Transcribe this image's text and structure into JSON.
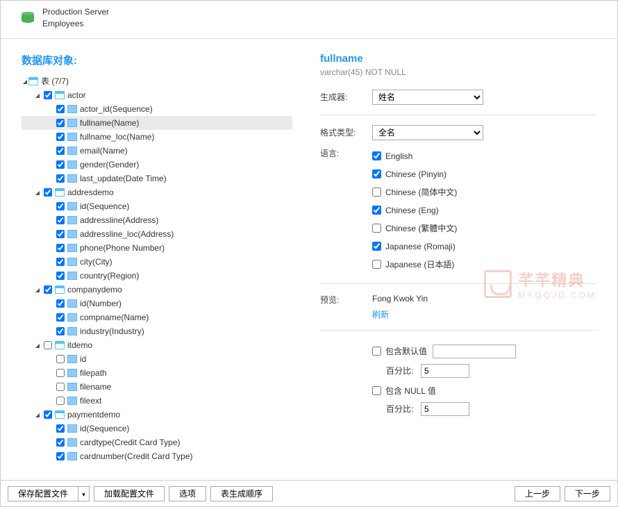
{
  "header": {
    "server": "Production Server",
    "db": "Employees"
  },
  "left_title": "数据库对象:",
  "tree_root_label": "表 (7/7)",
  "tables": [
    {
      "name": "actor",
      "checked": true,
      "expanded": true,
      "columns": [
        {
          "label": "actor_id(Sequence)",
          "checked": true
        },
        {
          "label": "fullname(Name)",
          "checked": true,
          "selected": true
        },
        {
          "label": "fullname_loc(Name)",
          "checked": true
        },
        {
          "label": "email(Name)",
          "checked": true
        },
        {
          "label": "gender(Gender)",
          "checked": true
        },
        {
          "label": "last_update(Date Time)",
          "checked": true
        }
      ]
    },
    {
      "name": "addresdemo",
      "checked": true,
      "expanded": true,
      "columns": [
        {
          "label": "id(Sequence)",
          "checked": true
        },
        {
          "label": "addressline(Address)",
          "checked": true
        },
        {
          "label": "addressline_loc(Address)",
          "checked": true
        },
        {
          "label": "phone(Phone Number)",
          "checked": true
        },
        {
          "label": "city(City)",
          "checked": true
        },
        {
          "label": "country(Region)",
          "checked": true
        }
      ]
    },
    {
      "name": "companydemo",
      "checked": true,
      "expanded": true,
      "columns": [
        {
          "label": "id(Number)",
          "checked": true
        },
        {
          "label": "compname(Name)",
          "checked": true
        },
        {
          "label": "industry(Industry)",
          "checked": true
        }
      ]
    },
    {
      "name": "itdemo",
      "checked": false,
      "expanded": true,
      "columns": [
        {
          "label": "id",
          "checked": false
        },
        {
          "label": "filepath",
          "checked": false
        },
        {
          "label": "filename",
          "checked": false
        },
        {
          "label": "fileext",
          "checked": false
        }
      ]
    },
    {
      "name": "paymentdemo",
      "checked": true,
      "expanded": true,
      "columns": [
        {
          "label": "id(Sequence)",
          "checked": true
        },
        {
          "label": "cardtype(Credit Card Type)",
          "checked": true
        },
        {
          "label": "cardnumber(Credit Card Type)",
          "checked": true
        }
      ]
    }
  ],
  "detail": {
    "title": "fullname",
    "subtitle": "varchar(45) NOT NULL",
    "generator_label": "生成器:",
    "generator_value": "姓名",
    "format_label": "格式类型:",
    "format_value": "全名",
    "language_label": "语言:",
    "languages": [
      {
        "label": "English",
        "checked": true
      },
      {
        "label": "Chinese (Pinyin)",
        "checked": true
      },
      {
        "label": "Chinese (简体中文)",
        "checked": false
      },
      {
        "label": "Chinese (Eng)",
        "checked": true
      },
      {
        "label": "Chinese (繁體中文)",
        "checked": false
      },
      {
        "label": "Japanese (Romaji)",
        "checked": true
      },
      {
        "label": "Japanese (日本語)",
        "checked": false
      }
    ],
    "preview_label": "预览:",
    "preview_value": "Fong Kwok Yin",
    "refresh": "刷新",
    "include_default_label": "包含默认值",
    "include_default_checked": false,
    "default_value": "",
    "percent_label": "百分比:",
    "percent1": "5",
    "include_null_label": "包含 NULL 值",
    "include_null_checked": false,
    "percent2": "5"
  },
  "watermark": {
    "main": "芊芊精典",
    "sub": "MYQQJD.COM"
  },
  "footer": {
    "save_profile": "保存配置文件",
    "load_profile": "加载配置文件",
    "options": "选项",
    "gen_order": "表生成顺序",
    "prev": "上一步",
    "next": "下一步"
  }
}
